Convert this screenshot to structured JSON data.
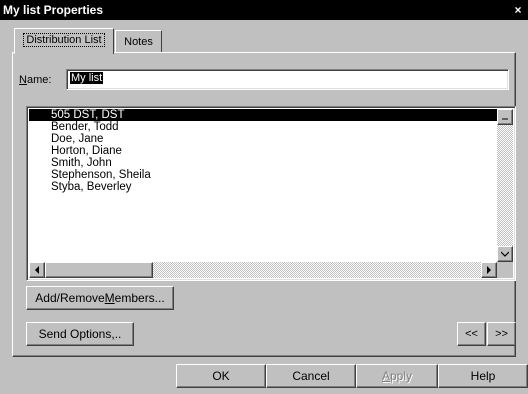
{
  "window": {
    "title": "My list Properties",
    "close_glyph": "×"
  },
  "tabs": [
    {
      "label": "Distribution List",
      "active": true
    },
    {
      "label": "Notes",
      "active": false
    }
  ],
  "name_field": {
    "label_prefix": "N",
    "label_rest": "ame:",
    "value": "My list"
  },
  "members": [
    "505 DST, DST",
    "Bender, Todd",
    "Doe, Jane",
    "Horton, Diane",
    "Smith, John",
    "Stephenson, Sheila",
    "Styba, Beverley"
  ],
  "selected_member_index": 0,
  "buttons": {
    "add_remove_pre": "Add/Remove ",
    "add_remove_ul": "M",
    "add_remove_post": "embers...",
    "send_options_pre": "Send Options",
    "send_options_ul": ",",
    "send_options_post": "..",
    "prev": "<<",
    "next": ">>",
    "ok": "OK",
    "cancel": "Cancel",
    "apply_ul": "A",
    "apply_post": "pply",
    "help": "Help"
  },
  "icons": {
    "scroll_up": "up-arrow-icon",
    "scroll_down": "down-arrow-icon",
    "scroll_left": "left-arrow-icon",
    "scroll_right": "right-arrow-icon"
  }
}
